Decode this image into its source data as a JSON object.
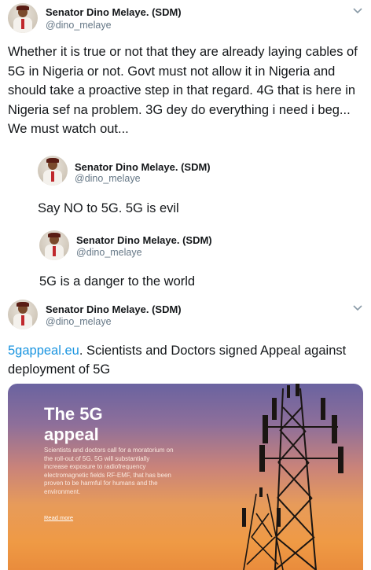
{
  "tweets": [
    {
      "name": "Senator Dino Melaye. (SDM)",
      "handle": "@dino_melaye",
      "text": "Whether it is true or not that they are already laying cables of 5G in Nigeria or not. Govt must not allow it in Nigeria and should take a proactive step in that regard. 4G that is here in Nigeria sef na problem. 3G dey do everything i need i beg... We must watch out..."
    },
    {
      "name": "Senator Dino Melaye. (SDM)",
      "handle": "@dino_melaye",
      "text": "Say NO to 5G. 5G is evil"
    },
    {
      "name": "Senator Dino Melaye. (SDM)",
      "handle": "@dino_melaye",
      "text": "5G is a danger to the world"
    },
    {
      "name": "Senator Dino Melaye. (SDM)",
      "handle": "@dino_melaye",
      "link": "5gappeal.eu",
      "text": ". Scientists and Doctors signed Appeal against deployment of 5G"
    }
  ],
  "card": {
    "title_line1": "The 5G",
    "title_line2": "appeal",
    "body": "Scientists and doctors call for a moratorium on the roll-out of 5G. 5G will substantially increase exposure to radiofrequency electromagnetic fields RF-EMF, that has been proven to be harmful for humans and the environment.",
    "read_more": "Read more"
  },
  "icons": {
    "menu": "chevron-down-icon"
  }
}
